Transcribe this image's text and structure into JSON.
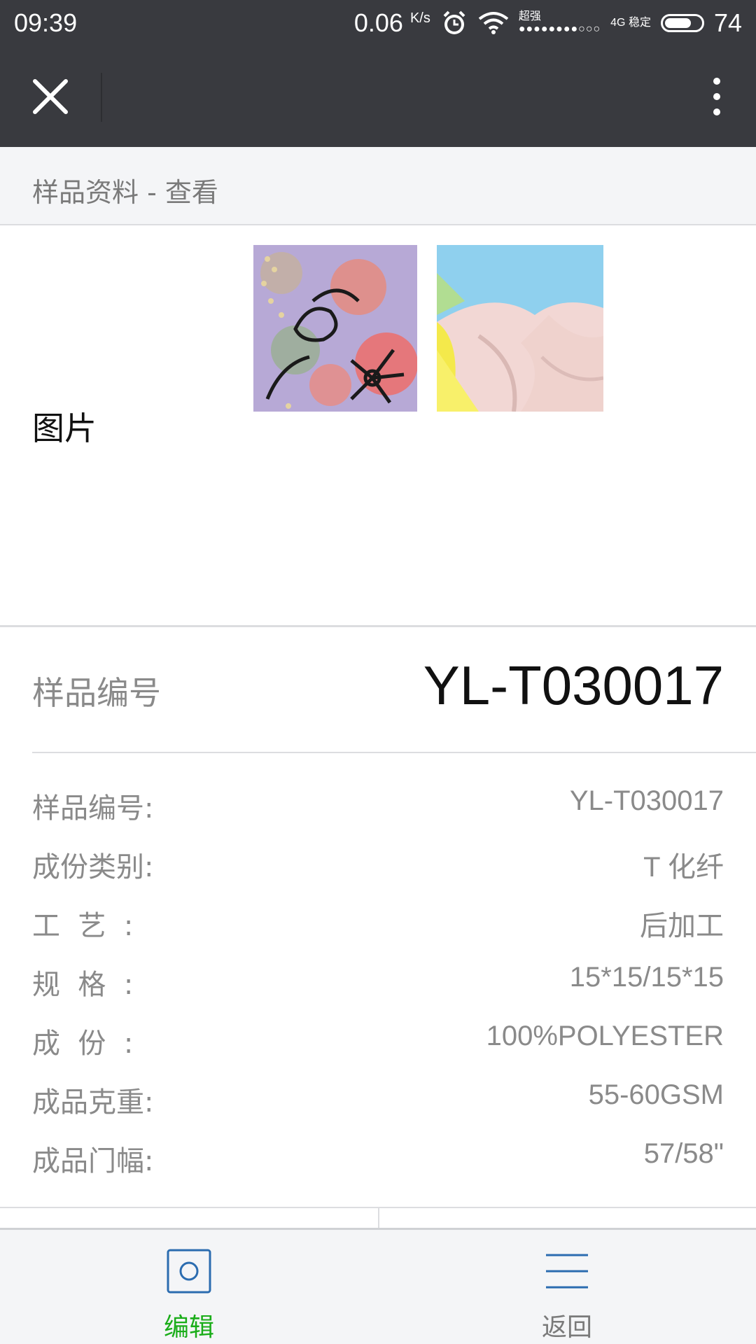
{
  "status_bar": {
    "time": "09:39",
    "speed": "0.06",
    "speed_unit": "K/s",
    "signal_top": "超强",
    "signal_bottom": "4G 稳定",
    "signal_dots": "●●●●●●●●○○○",
    "battery_percent": "74",
    "battery_level": 0.74
  },
  "nav": {
    "close_icon": "close-icon",
    "more_icon": "more-vertical-icon"
  },
  "page_header": {
    "title": "样品资料 - 查看"
  },
  "images": {
    "label": "图片",
    "items": [
      {
        "name": "floral-fabric-thumbnail"
      },
      {
        "name": "pastel-fabric-thumbnail"
      }
    ]
  },
  "sample_header": {
    "label": "样品编号",
    "value": "YL-T030017"
  },
  "details": [
    {
      "label": "样品编号:",
      "value": "YL-T030017"
    },
    {
      "label": "成份类别:",
      "value": "T 化纤"
    },
    {
      "label": "工  艺  :",
      "value": "后加工"
    },
    {
      "label": "规  格  :",
      "value": "15*15/15*15"
    },
    {
      "label": "成  份  :",
      "value": "100%POLYESTER"
    },
    {
      "label": "成品克重:",
      "value": "55-60GSM"
    },
    {
      "label": "成品门幅:",
      "value": "57/58\""
    }
  ],
  "tabs": {
    "edit_label": "编辑",
    "back_label": "返回",
    "active_color": "#1aad19",
    "icon_color": "#2b6cb0"
  }
}
